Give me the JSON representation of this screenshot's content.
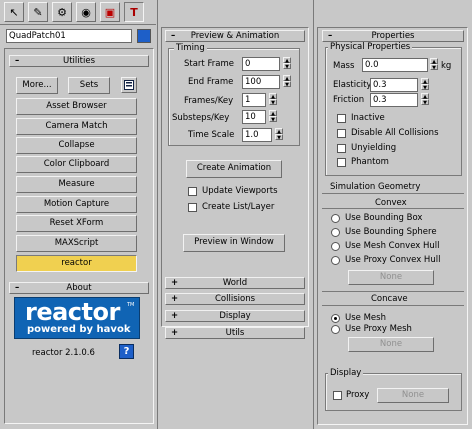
{
  "tabs": [
    {
      "icon": "create-icon",
      "glyph": "↖"
    },
    {
      "icon": "modify-icon",
      "glyph": "✎"
    },
    {
      "icon": "hierarchy-icon",
      "glyph": "⚙"
    },
    {
      "icon": "motion-icon",
      "glyph": "◉"
    },
    {
      "icon": "display-icon",
      "glyph": "▣"
    },
    {
      "icon": "utilities-icon",
      "glyph": "T"
    }
  ],
  "object_name": "QuadPatch01",
  "object_color": "#1e5fc8",
  "utilities": {
    "title": "Utilities",
    "more_label": "More...",
    "sets_label": "Sets",
    "items": [
      "Asset Browser",
      "Camera Match",
      "Collapse",
      "Color Clipboard",
      "Measure",
      "Motion Capture",
      "Reset XForm",
      "MAXScript",
      "reactor"
    ],
    "active_item": "reactor",
    "active_color": "#f0d050"
  },
  "about": {
    "title": "About",
    "logo_text": "reactor",
    "logo_tm": "TM",
    "logo_sub": "powered by havok",
    "logo_bg": "#1064b4",
    "version": "reactor 2.1.0.6",
    "help_label": "?"
  },
  "preview": {
    "title": "Preview & Animation",
    "timing_title": "Timing",
    "start_frame_label": "Start Frame",
    "start_frame": "0",
    "end_frame_label": "End Frame",
    "end_frame": "100",
    "frames_key_label": "Frames/Key",
    "frames_key": "1",
    "substeps_label": "Substeps/Key",
    "substeps": "10",
    "time_scale_label": "Time Scale",
    "time_scale": "1.0",
    "create_animation_label": "Create Animation",
    "update_viewports_label": "Update Viewports",
    "create_list_layer_label": "Create List/Layer",
    "preview_window_label": "Preview in Window"
  },
  "rollouts": [
    {
      "sign": "+",
      "label": "World"
    },
    {
      "sign": "+",
      "label": "Collisions"
    },
    {
      "sign": "+",
      "label": "Display"
    },
    {
      "sign": "+",
      "label": "Utils"
    }
  ],
  "properties": {
    "title": "Properties",
    "physical_title": "Physical Properties",
    "mass_label": "Mass",
    "mass": "0.0",
    "mass_unit": "kg",
    "elasticity_label": "Elasticity",
    "elasticity": "0.3",
    "friction_label": "Friction",
    "friction": "0.3",
    "checks": [
      "Inactive",
      "Disable All Collisions",
      "Unyielding",
      "Phantom"
    ],
    "sim_geometry_title": "Simulation Geometry",
    "convex_label": "Convex",
    "convex_options": [
      "Use Bounding Box",
      "Use Bounding Sphere",
      "Use Mesh Convex Hull",
      "Use Proxy Convex Hull"
    ],
    "none_label": "None",
    "concave_label": "Concave",
    "concave_options": [
      "Use Mesh",
      "Use Proxy Mesh"
    ],
    "concave_selected": "Use Mesh",
    "none2_label": "None",
    "display_title": "Display",
    "proxy_label": "Proxy",
    "none3_label": "None"
  }
}
